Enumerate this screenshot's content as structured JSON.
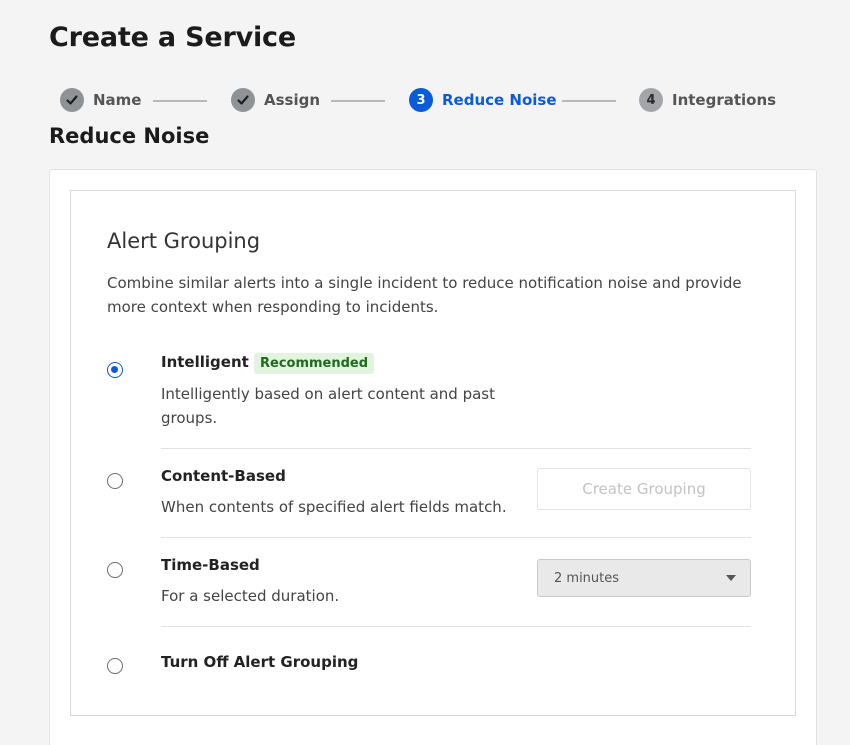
{
  "page": {
    "title": "Create a Service"
  },
  "steps": [
    {
      "label": "Name",
      "state": "done",
      "marker": ""
    },
    {
      "label": "Assign",
      "state": "done",
      "marker": ""
    },
    {
      "label": "Reduce Noise",
      "state": "current",
      "marker": "3"
    },
    {
      "label": "Integrations",
      "state": "todo",
      "marker": "4"
    }
  ],
  "section": {
    "title": "Reduce Noise"
  },
  "alert_grouping": {
    "title": "Alert Grouping",
    "description": "Combine similar alerts into a single incident to reduce notification noise and provide more context when responding to incidents.",
    "options": [
      {
        "title": "Intelligent",
        "badge": "Recommended",
        "description": "Intelligently based on alert content and past groups.",
        "selected": true
      },
      {
        "title": "Content-Based",
        "description": "When contents of specified alert fields match.",
        "action_label": "Create Grouping",
        "selected": false
      },
      {
        "title": "Time-Based",
        "description": "For a selected duration.",
        "select_value": "2 minutes",
        "selected": false
      },
      {
        "title": "Turn Off Alert Grouping",
        "selected": false
      }
    ]
  },
  "colors": {
    "accent": "#0a5bd7",
    "badge_bg": "#e2f3e0",
    "badge_text": "#1d6b1d"
  },
  "icons": {
    "done_step": "checkmark-icon",
    "select": "chevron-down-icon"
  }
}
